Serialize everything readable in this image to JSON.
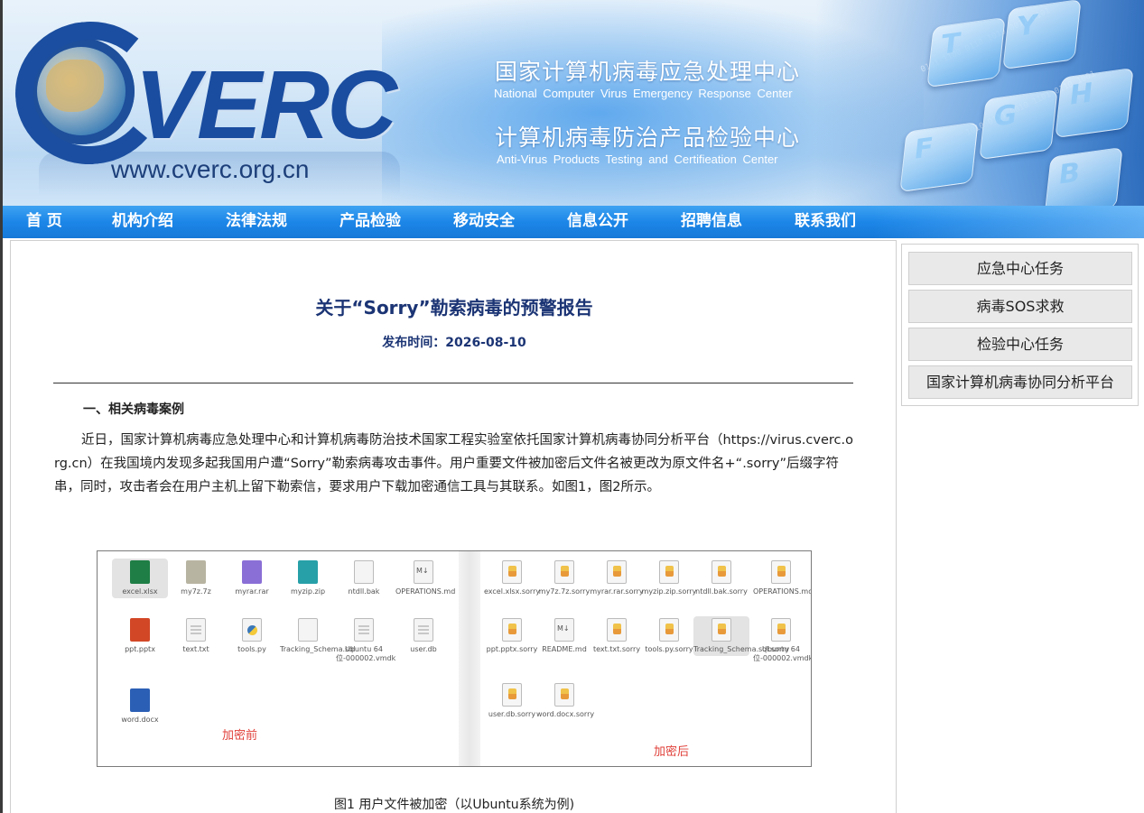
{
  "header": {
    "logo_text": "VERC",
    "logo_url": "www.cverc.org.cn",
    "org_cn_1": "国家计算机病毒应急处理中心",
    "org_en_1": "National  Computer  Virus  Emergency   Response  Center",
    "org_cn_2": "计算机病毒防治产品检验中心",
    "org_en_2": "Anti-Virus  Products  Testing  and  Certifieation  Center",
    "brand_color": "#1a4da0"
  },
  "nav": {
    "items": [
      {
        "label": "首 页"
      },
      {
        "label": "机构介绍"
      },
      {
        "label": "法律法规"
      },
      {
        "label": "产品检验"
      },
      {
        "label": "移动安全"
      },
      {
        "label": "信息公开"
      },
      {
        "label": "招聘信息"
      },
      {
        "label": "联系我们"
      }
    ],
    "color": "#1c86e8"
  },
  "article": {
    "title": "关于“Sorry”勒索病毒的预警报告",
    "publish_label": "发布时间：",
    "publish_date": "2026-08-10",
    "section_heading": "一、相关病毒案例",
    "paragraph": "近日，国家计算机病毒应急处理中心和计算机病毒防治技术国家工程实验室依托国家计算机病毒协同分析平台（https://virus.cverc.org.cn）在我国境内发现多起我国用户遭“Sorry”勒索病毒攻击事件。用户重要文件被加密后文件名被更改为原文件名+“.sorry”后缀字符串，同时，攻击者会在用户主机上留下勒索信，要求用户下载加密通信工具与其联系。如图1，图2所示。",
    "figure": {
      "before_label": "加密前",
      "after_label": "加密后",
      "before_files": [
        "excel.xlsx",
        "my7z.7z",
        "myrar.rar",
        "myzip.zip",
        "ntdll.bak",
        "OPERATIONS.md",
        "ppt.pptx",
        "text.txt",
        "tools.py",
        "Tracking_Schema.sql",
        "Ubuntu 64位-000002.vmdk",
        "user.db",
        "word.docx"
      ],
      "after_files": [
        "excel.xlsx.sorry",
        "my7z.7z.sorry",
        "myrar.rar.sorry",
        "myzip.zip.sorry",
        "ntdll.bak.sorry",
        "OPERATIONS.md.sorry",
        "ppt.pptx.sorry",
        "README.md",
        "text.txt.sorry",
        "tools.py.sorry",
        "Tracking_Schema.sql.sorry",
        "Ubuntu 64位-000002.vmdk.sorry",
        "user.db.sorry",
        "word.docx.sorry"
      ]
    },
    "figure_caption": "图1 用户文件被加密（以Ubuntu系统为例)"
  },
  "sidebar": {
    "items": [
      {
        "label": "应急中心任务"
      },
      {
        "label": "病毒SOS求救"
      },
      {
        "label": "检验中心任务"
      },
      {
        "label": "国家计算机病毒协同分析平台"
      }
    ]
  }
}
